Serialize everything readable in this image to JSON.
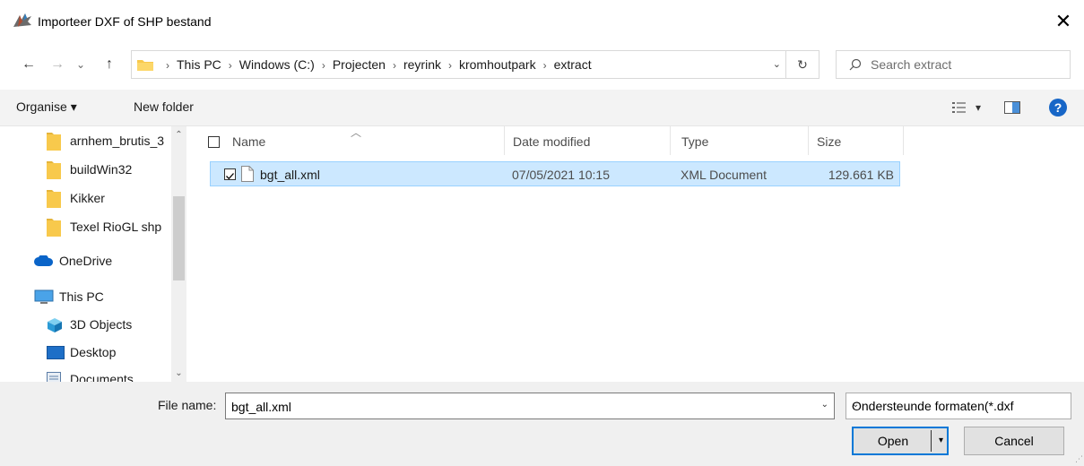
{
  "window": {
    "title": "Importeer DXF of SHP bestand",
    "close_glyph": "✕"
  },
  "nav": {
    "back_glyph": "←",
    "forward_glyph": "→",
    "recent_glyph": "⌄",
    "up_glyph": "↑",
    "breadcrumb": [
      "This PC",
      "Windows (C:)",
      "Projecten",
      "reyrink",
      "kromhoutpark",
      "extract"
    ],
    "separator": "›",
    "dropdown_glyph": "⌄",
    "refresh_glyph": "↻",
    "search_placeholder": "Search extract"
  },
  "toolbar": {
    "organise_label": "Organise ▾",
    "new_folder_label": "New folder",
    "view_dropdown_glyph": "▾",
    "help_glyph": "?"
  },
  "sidebar": {
    "items": [
      {
        "label": "arnhem_brutis_3",
        "icon": "folder-icon"
      },
      {
        "label": "buildWin32",
        "icon": "folder-icon"
      },
      {
        "label": "Kikker",
        "icon": "folder-icon"
      },
      {
        "label": "Texel RioGL shp",
        "icon": "folder-icon"
      },
      {
        "label": "OneDrive",
        "icon": "cloud-icon"
      },
      {
        "label": "This PC",
        "icon": "monitor-icon"
      },
      {
        "label": "3D Objects",
        "icon": "cube-icon"
      },
      {
        "label": "Desktop",
        "icon": "desktop-icon"
      },
      {
        "label": "Documents",
        "icon": "document-icon"
      }
    ],
    "scroll_up": "⌃",
    "scroll_down": "⌄"
  },
  "filelist": {
    "sort_indicator": "︿",
    "columns": {
      "name": "Name",
      "date": "Date modified",
      "type": "Type",
      "size": "Size"
    },
    "rows": [
      {
        "name": "bgt_all.xml",
        "date": "07/05/2021 10:15",
        "type": "XML Document",
        "size": "129.661 KB",
        "checked": true
      }
    ]
  },
  "bottom": {
    "filename_label": "File name:",
    "filename_value": "bgt_all.xml",
    "filename_dropdown_glyph": "⌄",
    "filetype_value": "Ondersteunde formaten(*.dxf",
    "filetype_dropdown_glyph": "⌄",
    "open_label": "Open",
    "open_dropdown_glyph": "▾",
    "cancel_label": "Cancel"
  },
  "colors": {
    "selection_fill": "#cce8ff",
    "selection_border": "#99d1ff",
    "accent": "#0078d7",
    "folder": "#f8c94c",
    "help": "#1766c7"
  }
}
